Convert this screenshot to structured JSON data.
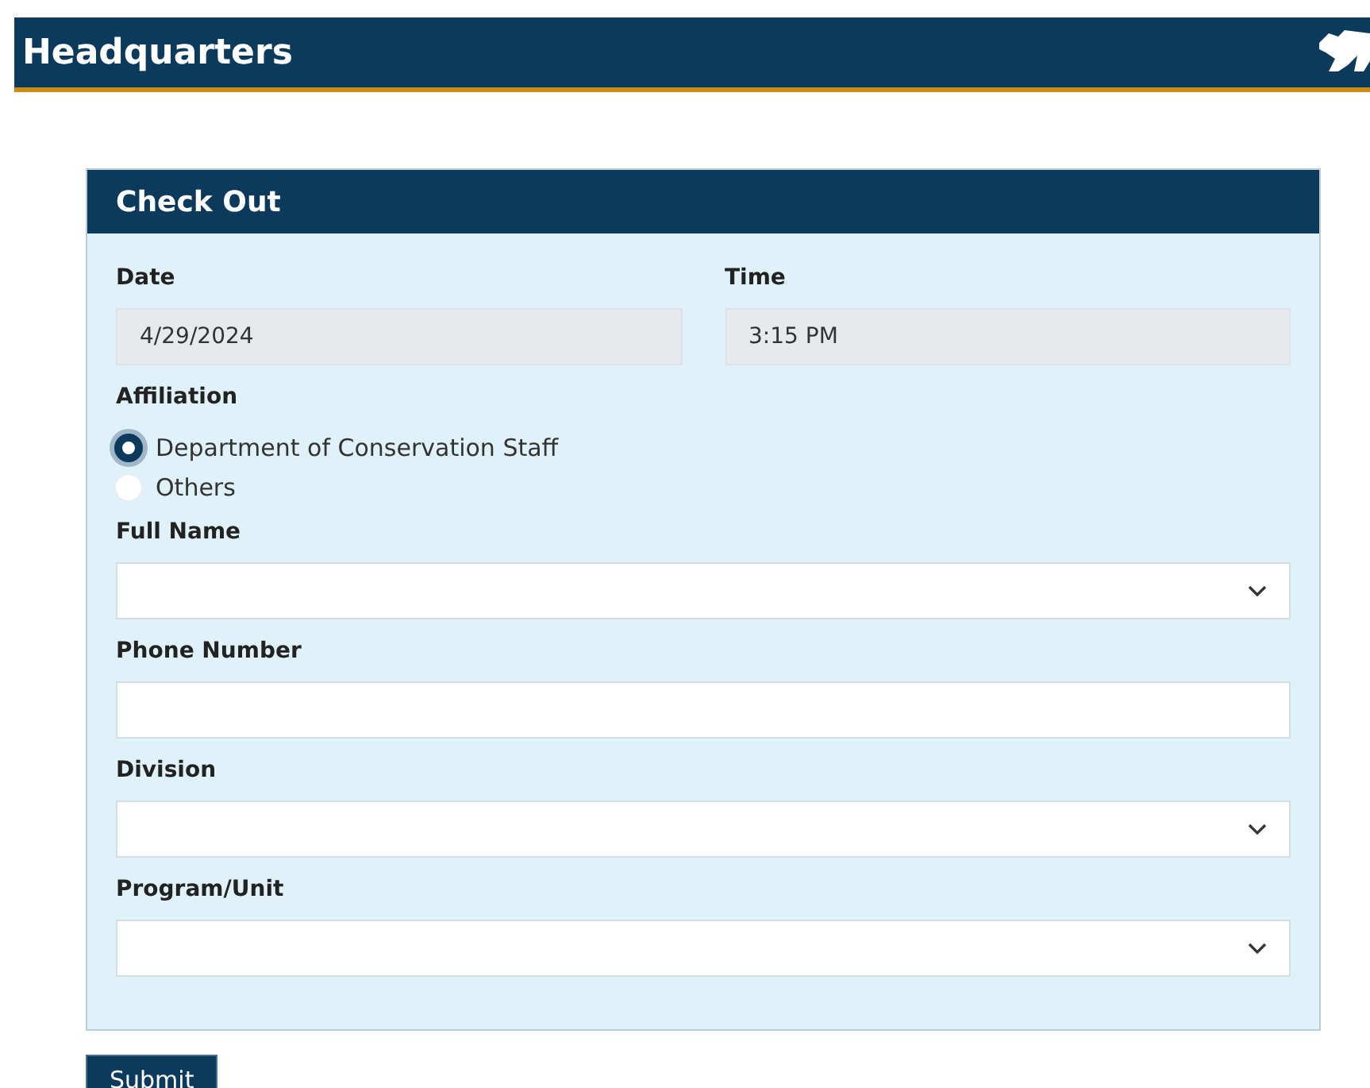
{
  "header": {
    "title": "Headquarters"
  },
  "form": {
    "title": "Check Out",
    "date": {
      "label": "Date",
      "value": "4/29/2024"
    },
    "time": {
      "label": "Time",
      "value": "3:15 PM"
    },
    "affiliation": {
      "label": "Affiliation",
      "options": [
        {
          "label": "Department of Conservation Staff",
          "selected": true
        },
        {
          "label": "Others",
          "selected": false
        }
      ]
    },
    "fields": [
      {
        "label": "Full Name",
        "kind": "select"
      },
      {
        "label": "Phone Number",
        "kind": "text"
      },
      {
        "label": "Division",
        "kind": "select"
      },
      {
        "label": "Program/Unit",
        "kind": "select"
      }
    ]
  },
  "submit": "Submit"
}
